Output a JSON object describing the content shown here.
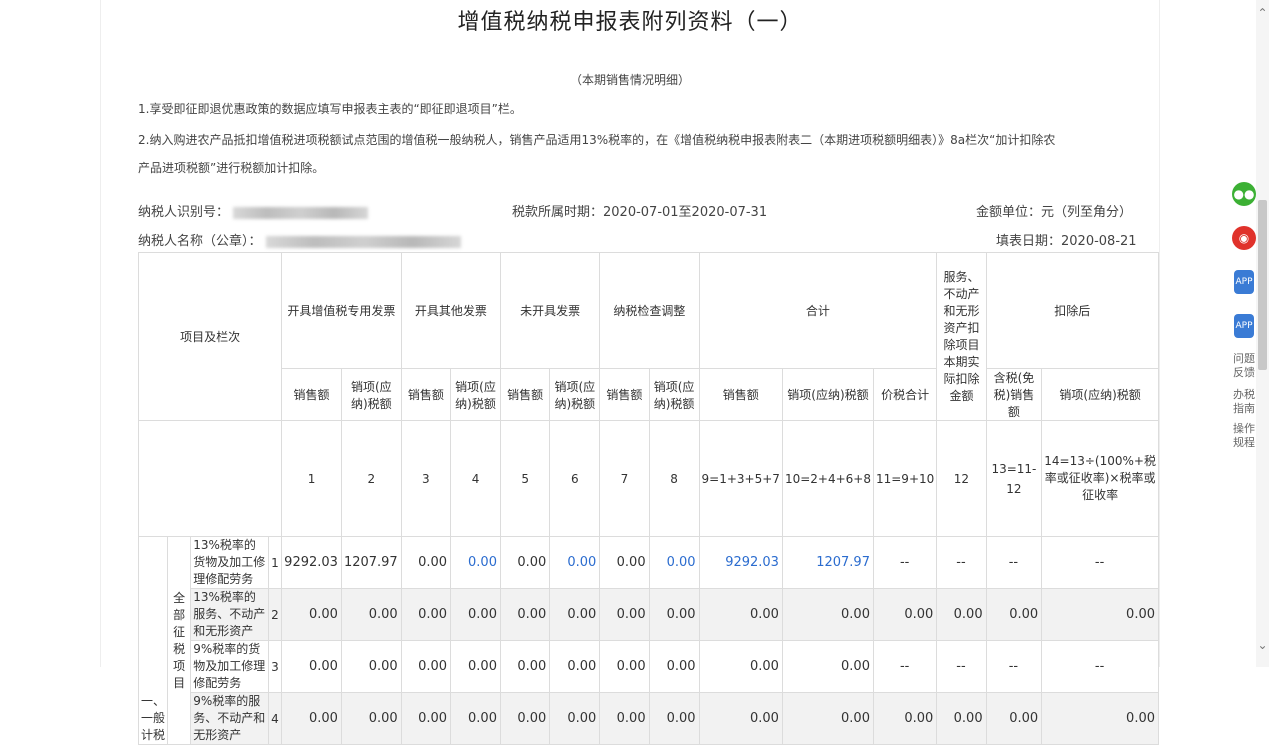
{
  "header": {
    "title": "增值税纳税申报表附列资料（一）",
    "subtitle": "（本期销售情况明细）",
    "note1": "1.享受即征即退优惠政策的数据应填写申报表主表的“即征即退项目”栏。",
    "note2a": "2.纳入购进农产品抵扣增值税进项税额试点范围的增值税一般纳税人，销售产品适用13%税率的，在《增值税纳税申报表附表二（本期进项税额明细表）》8a栏次“加计扣除农",
    "note2b": "产品进项税额”进行税额加计扣除。"
  },
  "info": {
    "taxpayer_id_label": "纳税人识别号：",
    "taxpayer_name_label": "纳税人名称（公章）：",
    "period": "税款所属时期：2020-07-01至2020-07-31",
    "unit": "金额单位：元（列至角分）",
    "fill_date": "填表日期：2020-08-21"
  },
  "table": {
    "item_header": "项目及栏次",
    "groups": {
      "special_invoice": "开具增值税专用发票",
      "other_invoice": "开具其他发票",
      "no_invoice": "未开具发票",
      "inspection": "纳税检查调整",
      "total": "合计",
      "deduction": "服务、不动产和无形资产扣除项目本期实际扣除金额",
      "after": "扣除后"
    },
    "sub": {
      "sales": "销售额",
      "tax": "销项(应纳)税额",
      "price_tax_total": "价税合计",
      "after_sales": "含税(免税)销售额",
      "after_tax": "销项(应纳)税额"
    },
    "col_nums": [
      "1",
      "2",
      "3",
      "4",
      "5",
      "6",
      "7",
      "8",
      "9=1+3+5+7",
      "10=2+4+6+8",
      "11=9+10",
      "12",
      "13=11-12",
      "14=13÷(100%+税率或征收率)×税率或征收率"
    ],
    "side": {
      "level1": "一、一般计税",
      "level2": "全部征税项目"
    },
    "rows": [
      {
        "label": "13%税率的货物及加工修理修配劳务",
        "no": "1",
        "cells": [
          "9292.03",
          "1207.97",
          "0.00",
          "0.00",
          "0.00",
          "0.00",
          "0.00",
          "0.00",
          "9292.03",
          "1207.97",
          "--",
          "--",
          "--",
          "--"
        ]
      },
      {
        "label": "13%税率的服务、不动产和无形资产",
        "no": "2",
        "cells": [
          "0.00",
          "0.00",
          "0.00",
          "0.00",
          "0.00",
          "0.00",
          "0.00",
          "0.00",
          "0.00",
          "0.00",
          "0.00",
          "0.00",
          "0.00",
          "0.00"
        ]
      },
      {
        "label": "9%税率的货物及加工修理修配劳务",
        "no": "3",
        "cells": [
          "0.00",
          "0.00",
          "0.00",
          "0.00",
          "0.00",
          "0.00",
          "0.00",
          "0.00",
          "0.00",
          "0.00",
          "--",
          "--",
          "--",
          "--"
        ]
      },
      {
        "label": "9%税率的服务、不动产和无形资产",
        "no": "4",
        "cells": [
          "0.00",
          "0.00",
          "0.00",
          "0.00",
          "0.00",
          "0.00",
          "0.00",
          "0.00",
          "0.00",
          "0.00",
          "0.00",
          "0.00",
          "0.00",
          "0.00"
        ]
      }
    ]
  },
  "sidebar": {
    "wechat_icon": "wechat-icon",
    "weibo_icon": "weibo-icon",
    "app1": "APP",
    "app2": "APP",
    "feedback": "问题反馈",
    "guide": "办税指南",
    "manual": "操作规程"
  },
  "colors": {
    "blue": "#2b6ccf",
    "wechat": "#3cb034",
    "weibo": "#e0322b",
    "app": "#3a7bd5"
  }
}
